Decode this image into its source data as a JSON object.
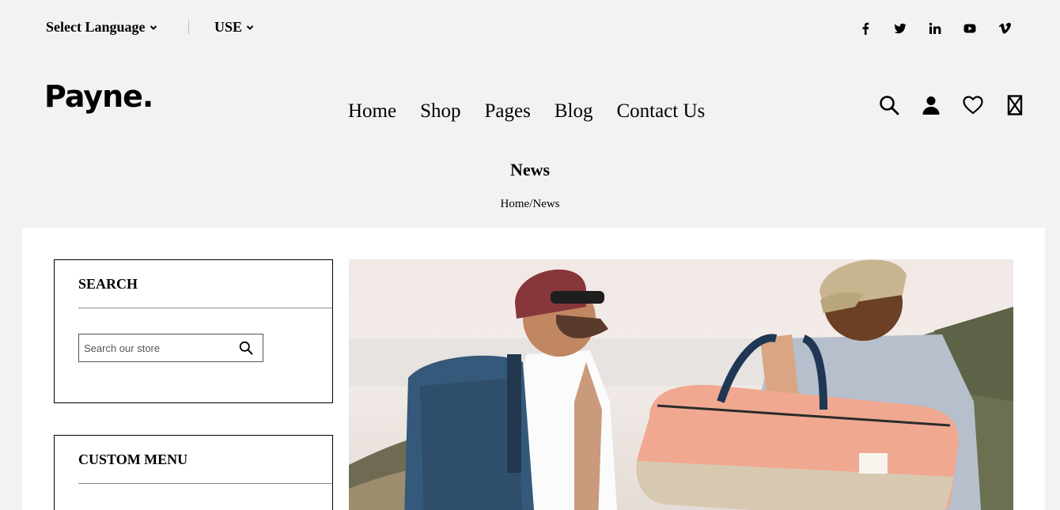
{
  "topbar": {
    "language_label": "Select Language",
    "currency_label": "USE",
    "social": [
      "facebook-icon",
      "twitter-icon",
      "linkedin-icon",
      "youtube-icon",
      "vimeo-icon"
    ]
  },
  "header": {
    "logo": "Payne.",
    "nav": [
      "Home",
      "Shop",
      "Pages",
      "Blog",
      "Contact Us"
    ],
    "icons": [
      "search-icon",
      "user-icon",
      "heart-icon",
      "cart-icon"
    ]
  },
  "page": {
    "title": "News",
    "breadcrumb_home": "Home",
    "breadcrumb_sep": "/",
    "breadcrumb_current": "News"
  },
  "sidebar": {
    "search_title": "SEARCH",
    "search_placeholder": "Search our store",
    "custom_menu_title": "CUSTOM MENU"
  },
  "colors": {
    "background": "#f3f2f2",
    "content_bg": "#ffffff",
    "text": "#000000"
  }
}
